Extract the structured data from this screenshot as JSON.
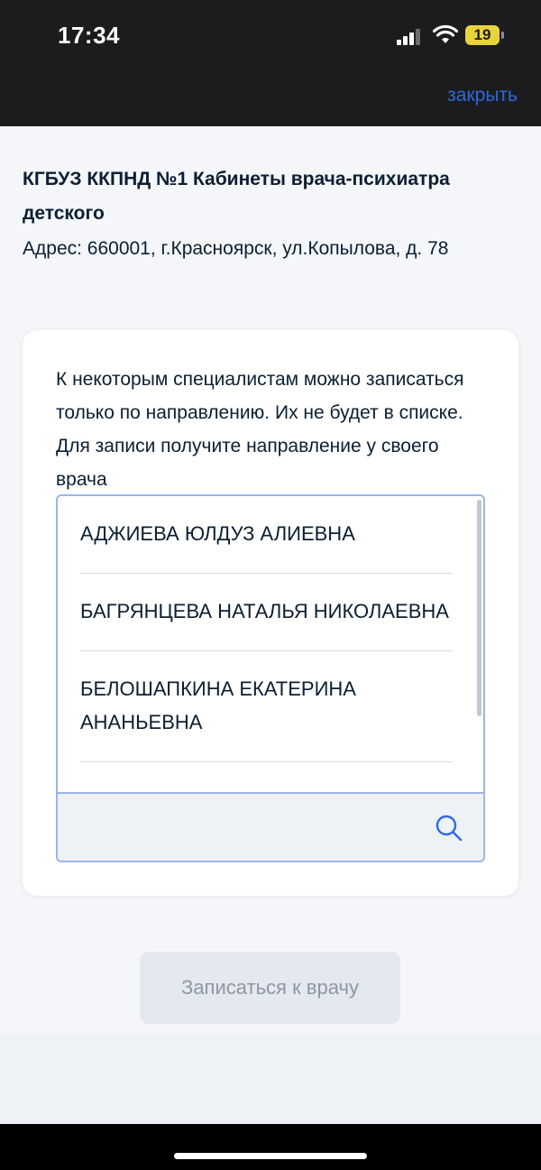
{
  "status_bar": {
    "time": "17:34",
    "battery_level": "19",
    "signal_icon": "cellular-signal-icon",
    "wifi_icon": "wifi-icon",
    "battery_icon": "battery-icon"
  },
  "nav": {
    "close_label": "закрыть"
  },
  "clinic": {
    "name": "КГБУЗ ККПНД №1 Кабинеты врача-психиатра детского",
    "address": "Адрес: 660001, г.Красноярск, ул.Копылова, д. 78"
  },
  "card": {
    "hint": "К некоторым специалистам можно записаться только по направлению. Их не будет в списке. Для записи получите направление у своего врача"
  },
  "doctors": {
    "items": [
      "АДЖИЕВА ЮЛДУЗ АЛИЕВНА",
      "БАГРЯНЦЕВА НАТАЛЬЯ НИКОЛАЕВНА",
      "БЕЛОШАПКИНА ЕКАТЕРИНА АНАНЬЕВНА"
    ]
  },
  "search": {
    "value": "",
    "icon": "search-icon"
  },
  "actions": {
    "submit_label": "Записаться к врачу"
  },
  "colors": {
    "accent": "#2c68e0",
    "picker_border": "#9db4e8",
    "button_disabled_bg": "#e4e8ef",
    "button_disabled_text": "#8d97a5",
    "battery": "#e9d33a"
  }
}
